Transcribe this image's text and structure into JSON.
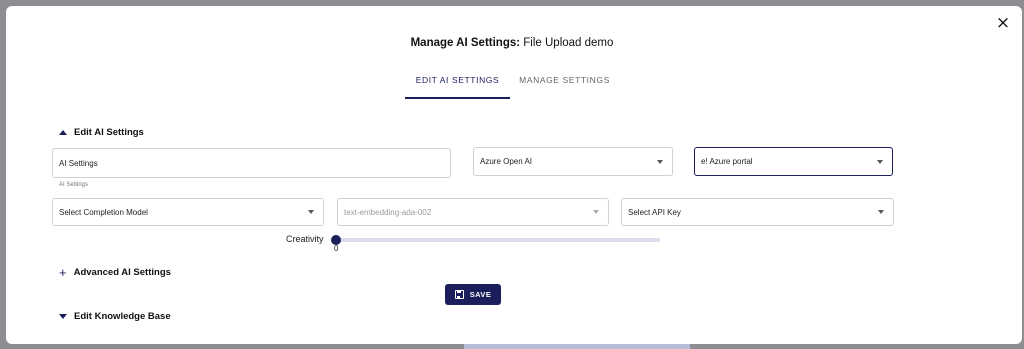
{
  "dialog": {
    "close_label": "×",
    "title_bold": "Manage AI Settings:",
    "title_rest": " File Upload demo"
  },
  "tabs": [
    {
      "label": "EDIT AI SETTINGS",
      "active": true
    },
    {
      "label": "MANAGE SETTINGS",
      "active": false
    }
  ],
  "sections": {
    "edit_ai": "Edit AI Settings",
    "advanced": "Advanced AI Settings",
    "knowledge_base": "Edit Knowledge Base"
  },
  "form": {
    "ai_settings_name": {
      "value": "AI Settings",
      "helper": "AI Settings"
    },
    "provider": {
      "value": "Azure Open AI"
    },
    "deployment": {
      "value": "e! Azure portal"
    },
    "completion_model": {
      "value": "Select Completion Model"
    },
    "embedding_model": {
      "value": "text-embedding-ada-002"
    },
    "api_key": {
      "value": "Select API Key"
    },
    "creativity": {
      "label": "Creativity",
      "value": 0,
      "value_text": "0"
    }
  },
  "actions": {
    "save_label": "SAVE"
  },
  "colors": {
    "accent": "#1a1f5c",
    "overlay": "#8e8e92"
  }
}
